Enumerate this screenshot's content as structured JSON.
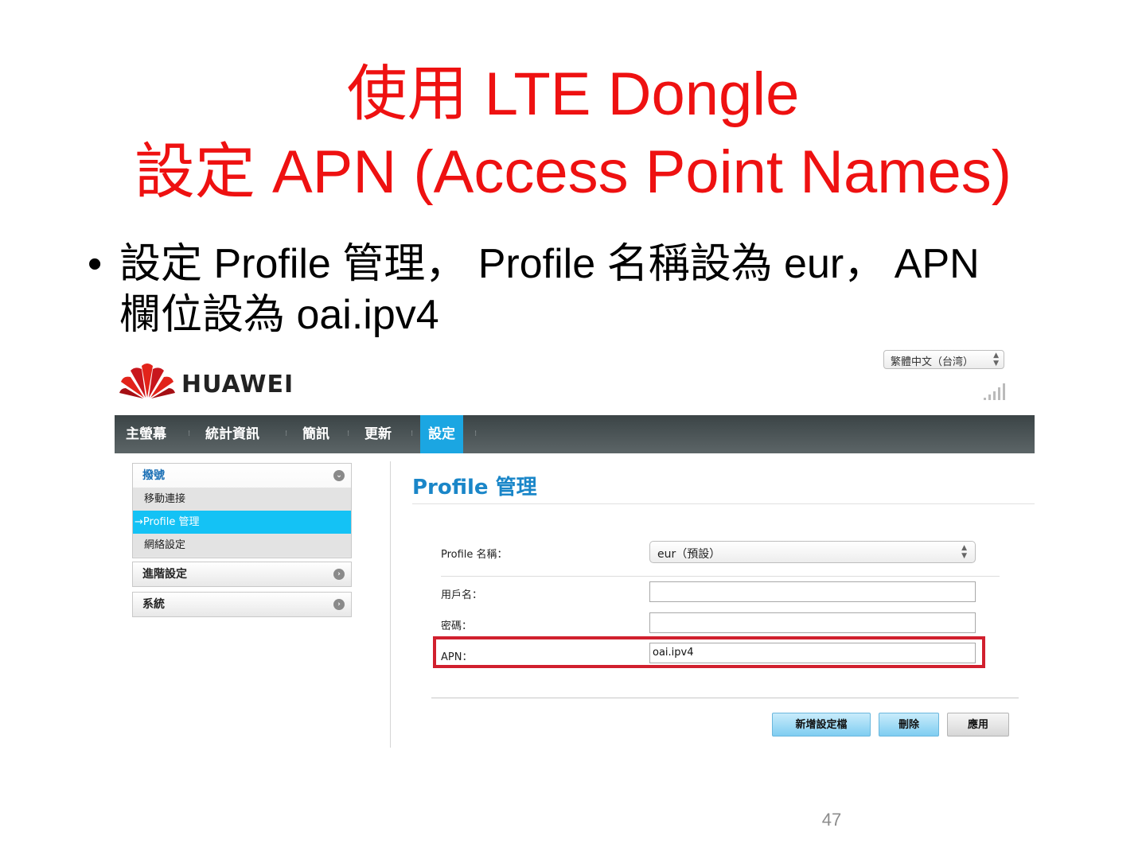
{
  "slide": {
    "title_line1": "使用 LTE Dongle",
    "title_line2": "設定 APN (Access Point Names)",
    "bullet_marker": "•",
    "bullet_line1": "設定 Profile 管理，  Profile 名稱設為 eur，  APN",
    "bullet_line2": "欄位設為 oai.ipv4",
    "page_number": "47"
  },
  "router_ui": {
    "language_select": "繁體中文（台湾）",
    "brand": "HUAWEI",
    "nav": [
      "主螢幕",
      "統計資訊",
      "簡訊",
      "更新",
      "設定"
    ],
    "active_nav": "設定",
    "sidebar": {
      "group1": {
        "label": "撥號",
        "items": [
          "移動連接",
          "→Profile 管理",
          "網絡設定"
        ],
        "active_item": "→Profile 管理"
      },
      "group2": {
        "label": "進階設定"
      },
      "group3": {
        "label": "系統"
      }
    },
    "content": {
      "title": "Profile 管理",
      "profile_name_label": "Profile 名稱：",
      "profile_name_value": "eur（預設）",
      "username_label": "用戶名：",
      "username_value": "",
      "password_label": "密碼：",
      "password_value": "",
      "apn_label": "APN：",
      "apn_value": "oai.ipv4"
    },
    "buttons": {
      "new_profile": "新增設定檔",
      "delete": "刪除",
      "apply": "應用"
    },
    "colors": {
      "nav_active": "#1ba6e2",
      "sidebar_active": "#14c2f5",
      "title_blue": "#1a86c8",
      "highlight_red": "#d1202e",
      "slide_title_red": "#ee1111"
    }
  }
}
